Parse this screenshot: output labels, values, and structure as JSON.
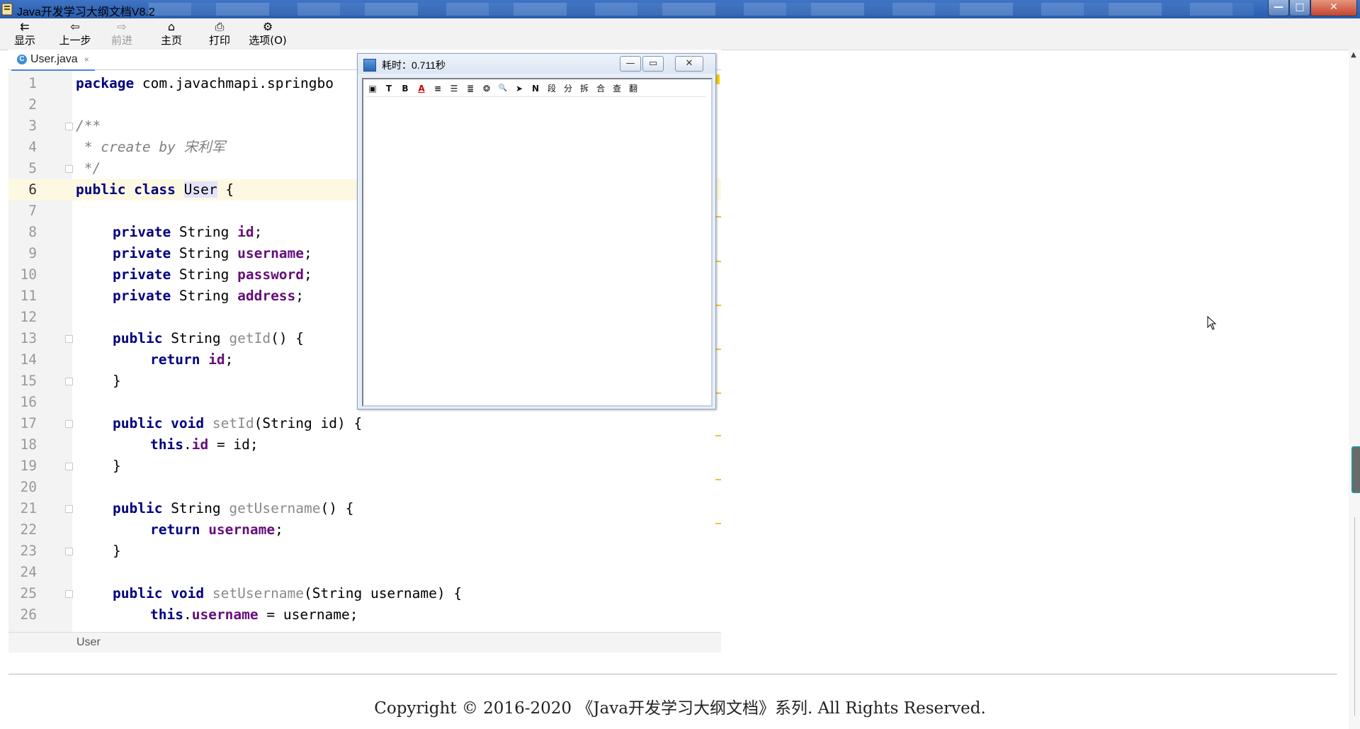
{
  "window": {
    "title": "Java开发学习大纲文档V8.2",
    "controls": {
      "minimize": "—",
      "maximize": "□",
      "close": "✕"
    }
  },
  "toolbar": {
    "show": {
      "icon": "show-icon",
      "label": "显示"
    },
    "back": {
      "icon": "back-arrow-icon",
      "label": "上一步"
    },
    "forward": {
      "icon": "forward-arrow-icon",
      "label": "前进",
      "disabled": true
    },
    "home": {
      "icon": "home-icon",
      "label": "主页"
    },
    "print": {
      "icon": "printer-icon",
      "label": "打印"
    },
    "options": {
      "icon": "options-icon",
      "label": "选项(O)"
    }
  },
  "editor": {
    "tab": {
      "label": "User.java",
      "icon": "class-icon",
      "icon_text": "C",
      "close": "×"
    },
    "current_line": 6,
    "lines": [
      {
        "n": "1"
      },
      {
        "n": "2"
      },
      {
        "n": "3"
      },
      {
        "n": "4"
      },
      {
        "n": "5"
      },
      {
        "n": "6"
      },
      {
        "n": "7"
      },
      {
        "n": "8"
      },
      {
        "n": "9"
      },
      {
        "n": "10"
      },
      {
        "n": "11"
      },
      {
        "n": "12"
      },
      {
        "n": "13"
      },
      {
        "n": "14"
      },
      {
        "n": "15"
      },
      {
        "n": "16"
      },
      {
        "n": "17"
      },
      {
        "n": "18"
      },
      {
        "n": "19"
      },
      {
        "n": "20"
      },
      {
        "n": "21"
      },
      {
        "n": "22"
      },
      {
        "n": "23"
      },
      {
        "n": "24"
      },
      {
        "n": "25"
      },
      {
        "n": "26"
      }
    ],
    "code": {
      "l1_kw": "package",
      "l1_rest": " com.javachmapi.springbo",
      "l3": "/**",
      "l4": " * create by 宋利军",
      "l5": " */",
      "l6_kw": "public class ",
      "l6_name": "User",
      "l6_rest": " {",
      "l8_kw": "private",
      "l8_type": " String ",
      "l8_field": "id",
      "l8_end": ";",
      "l9_kw": "private",
      "l9_type": " String ",
      "l9_field": "username",
      "l9_end": ";",
      "l10_kw": "private",
      "l10_type": " String ",
      "l10_field": "password",
      "l10_end": ";",
      "l11_kw": "private",
      "l11_type": " String ",
      "l11_field": "address",
      "l11_end": ";",
      "l13_kw": "public",
      "l13_type": " String ",
      "l13_meth": "getId",
      "l13_rest": "() {",
      "l14_kw": "return ",
      "l14_field": "id",
      "l14_end": ";",
      "l15": "}",
      "l17_kw": "public void ",
      "l17_meth": "setId",
      "l17_rest": "(String id) {",
      "l18_kw": "this",
      "l18_dot": ".",
      "l18_field": "id",
      "l18_rest": " = id;",
      "l19": "}",
      "l21_kw": "public",
      "l21_type": " String ",
      "l21_meth": "getUsername",
      "l21_rest": "() {",
      "l22_kw": "return ",
      "l22_field": "username",
      "l22_end": ";",
      "l23": "}",
      "l25_kw": "public void ",
      "l25_meth": "setUsername",
      "l25_rest": "(String username) {",
      "l26_kw": "this",
      "l26_dot": ".",
      "l26_field": "username",
      "l26_rest": " = username;"
    },
    "breadcrumb": "User"
  },
  "popup": {
    "title": "耗时：0.711秒",
    "controls": {
      "minimize": "—",
      "maximize": "▭",
      "close": "✕"
    },
    "tools": [
      {
        "icon": "box-icon",
        "glyph": "▣"
      },
      {
        "icon": "text-icon",
        "glyph": "T"
      },
      {
        "icon": "bold-icon",
        "glyph": "B"
      },
      {
        "icon": "font-color-icon",
        "glyph": "A"
      },
      {
        "icon": "align-left-icon",
        "glyph": "≡"
      },
      {
        "icon": "align-center-icon",
        "glyph": "☰"
      },
      {
        "icon": "align-right-icon",
        "glyph": "≣"
      },
      {
        "icon": "palette-icon",
        "glyph": "❂"
      },
      {
        "icon": "search-icon",
        "glyph": "🔍"
      },
      {
        "icon": "send-icon",
        "glyph": "➤"
      },
      {
        "icon": "n-icon",
        "glyph": "N"
      },
      {
        "icon": "paragraph-icon",
        "glyph": "段"
      },
      {
        "icon": "split-icon",
        "glyph": "分"
      },
      {
        "icon": "break-icon",
        "glyph": "拆"
      },
      {
        "icon": "merge-icon",
        "glyph": "合"
      },
      {
        "icon": "lookup-icon",
        "glyph": "查"
      },
      {
        "icon": "translate-icon",
        "glyph": "翻"
      }
    ]
  },
  "footer": {
    "copyright": "Copyright © 2016-2020 《Java开发学习大纲文档》系列. All Rights Reserved."
  },
  "colors": {
    "keyword": "#000080",
    "field": "#660e7a",
    "comment": "#808080",
    "current_line": "#fdf8e1",
    "title_bar": "#2a5cab"
  }
}
